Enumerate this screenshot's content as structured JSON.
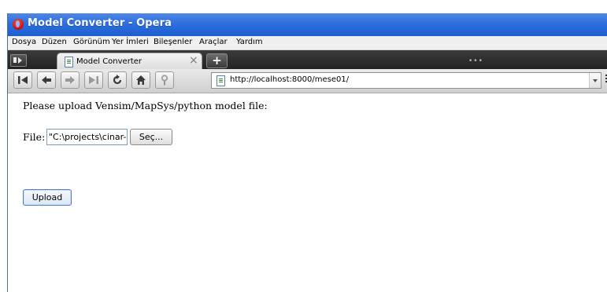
{
  "window": {
    "title": "Model Converter - Opera"
  },
  "menu": {
    "items": [
      {
        "label": "Dosya"
      },
      {
        "label": "Düzen"
      },
      {
        "label": "Görünüm"
      },
      {
        "label": "Yer İmleri"
      },
      {
        "label": "Bileşenler"
      },
      {
        "label": "Araçlar"
      },
      {
        "label": "Yardım"
      }
    ]
  },
  "tabs": [
    {
      "label": "Model Converter",
      "close": "×"
    }
  ],
  "tabbar": {
    "new_tab": "+",
    "grip": "•••"
  },
  "address": {
    "url": "http://localhost:8000/mese01/"
  },
  "nav": {
    "icons": [
      "rewind-icon",
      "back-icon",
      "forward-icon",
      "fast-forward-icon",
      "reload-icon",
      "home-icon",
      "key-icon"
    ]
  },
  "page": {
    "intro": "Please upload Vensim/MapSys/python model file:",
    "file_label": "File:",
    "file_value": "\"C:\\projects\\cinar-aga",
    "browse_label": "Seç...",
    "upload_label": "Upload"
  }
}
